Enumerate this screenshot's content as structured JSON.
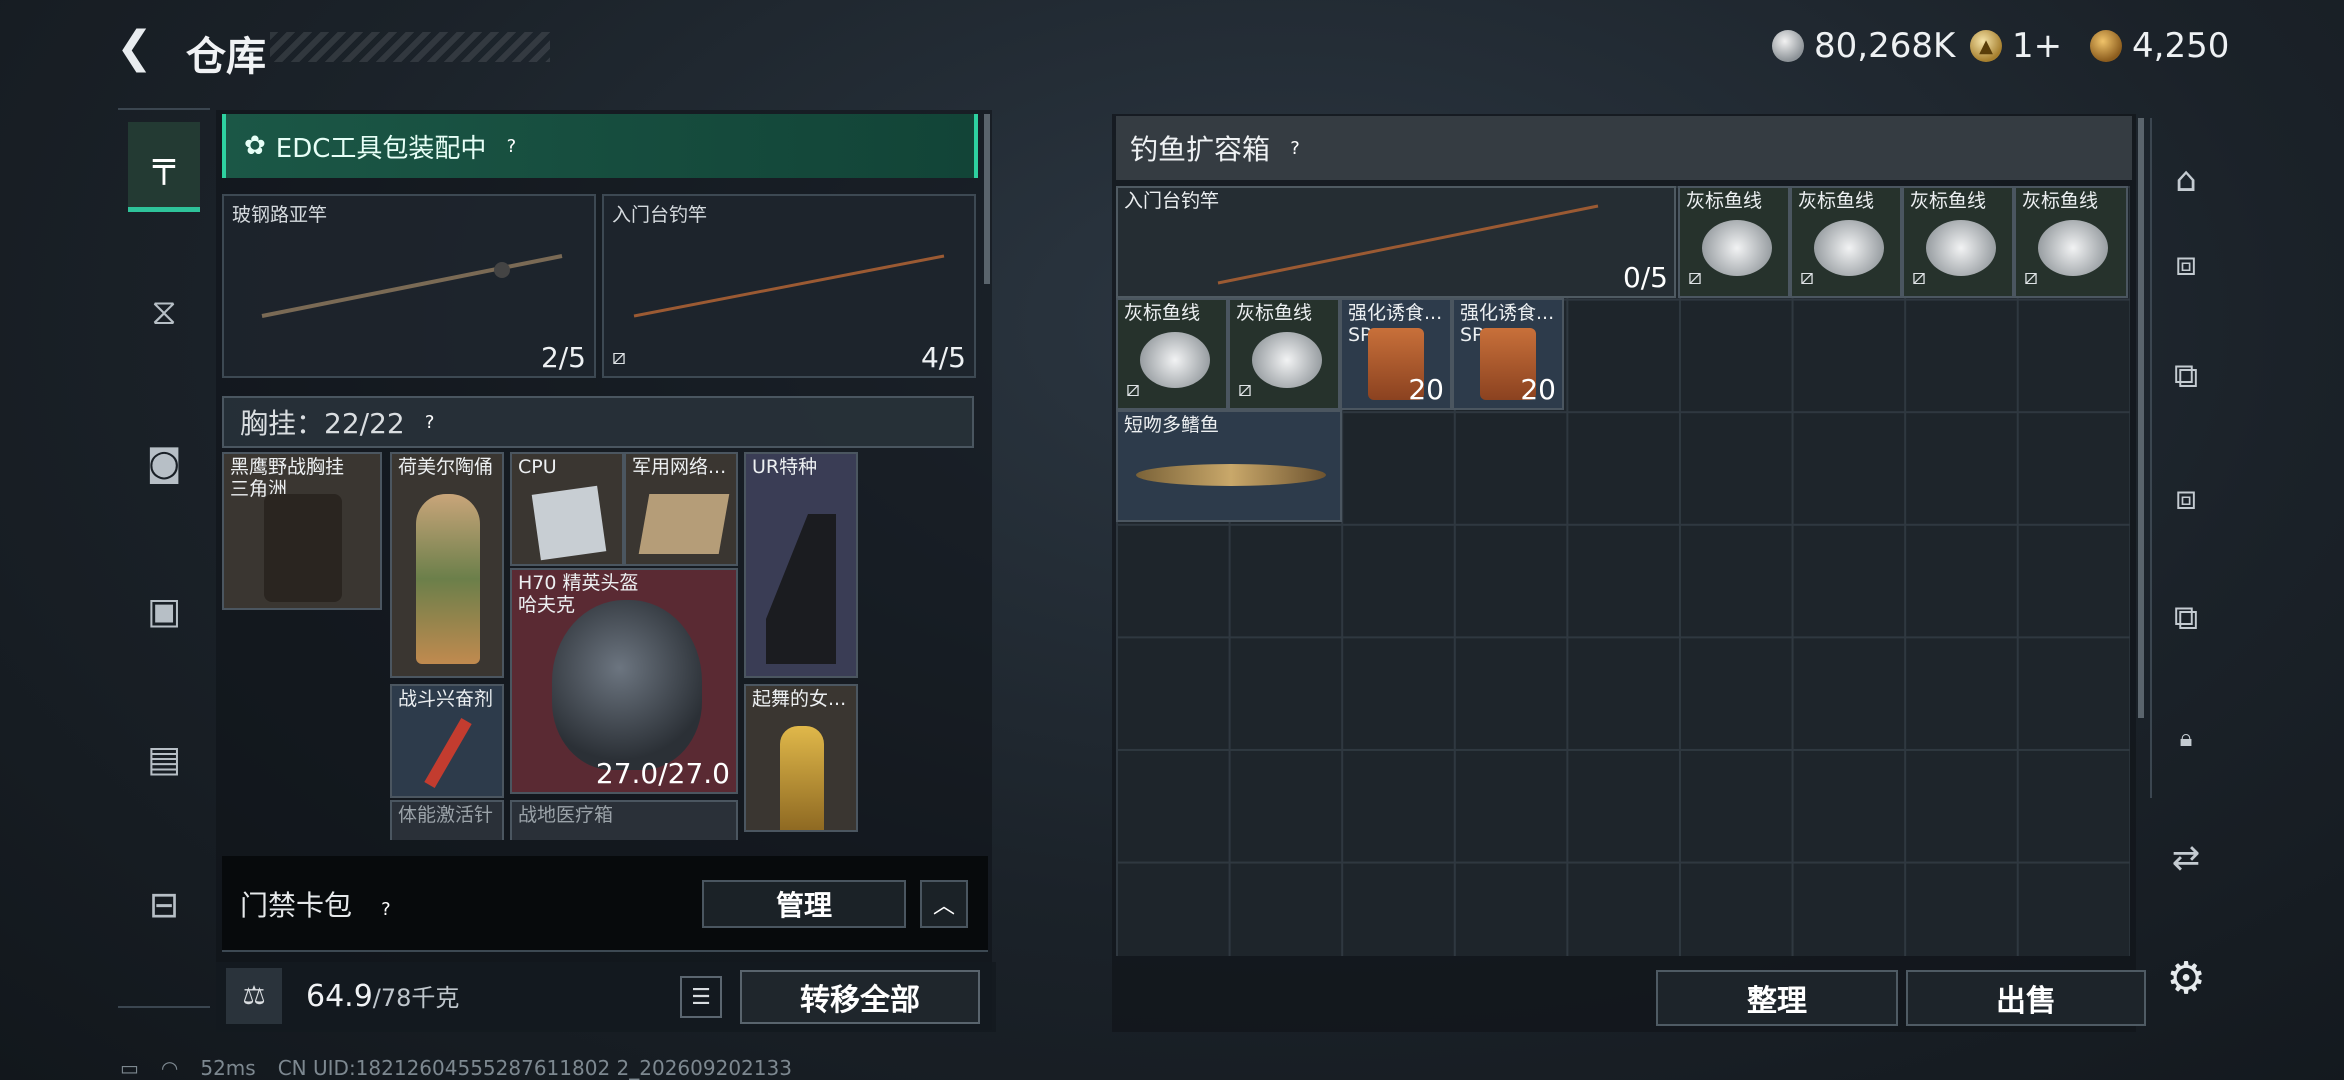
{
  "header": {
    "title": "仓库",
    "currencies": [
      {
        "icon": "silver-coin-icon",
        "value": "80,268K"
      },
      {
        "icon": "gold-ticket-icon",
        "value": "1+"
      },
      {
        "icon": "gold-coin-icon",
        "value": "4,250"
      }
    ]
  },
  "tabs": [
    {
      "name": "weapons",
      "icon": "pistol-icon",
      "active": true
    },
    {
      "name": "armor",
      "icon": "vest-icon",
      "active": false
    },
    {
      "name": "helmet",
      "icon": "helmet-icon",
      "active": false
    },
    {
      "name": "backpack",
      "icon": "backpack-icon",
      "active": false
    },
    {
      "name": "chest-rig",
      "icon": "rig-icon",
      "active": false
    },
    {
      "name": "case",
      "icon": "briefcase-icon",
      "active": false
    }
  ],
  "left": {
    "edc_label": "EDC工具包装配中",
    "rods": [
      {
        "label": "玻钢路亚竿",
        "count": "2/5"
      },
      {
        "label": "入门台钓竿",
        "count": "4/5"
      }
    ],
    "chest_label": "胸挂：22/22",
    "items": [
      {
        "label": "黑鹰野战胸挂\n三角洲"
      },
      {
        "label": "荷美尔陶俑"
      },
      {
        "label": "CPU"
      },
      {
        "label": "军用网络..."
      },
      {
        "label": "UR特种"
      },
      {
        "label": "H70 精英头盔\n哈夫克",
        "count": "27.0/27.0"
      },
      {
        "label": "战斗兴奋剂"
      },
      {
        "label": "起舞的女..."
      },
      {
        "label": "体能激活针"
      },
      {
        "label": "战地医疗箱"
      }
    ],
    "card_pack_label": "门禁卡包",
    "manage_label": "管理",
    "weight_value": "64.9",
    "weight_max": "/78千克",
    "transfer_label": "转移全部"
  },
  "right": {
    "title": "钓鱼扩容箱",
    "grid_items": [
      {
        "label": "入门台钓竿",
        "count": "0/5"
      },
      {
        "label": "灰标鱼线"
      },
      {
        "label": "灰标鱼线"
      },
      {
        "label": "灰标鱼线"
      },
      {
        "label": "灰标鱼线"
      },
      {
        "label": "灰标鱼线"
      },
      {
        "label": "灰标鱼线"
      },
      {
        "label": "强化诱食...",
        "sub": "SP",
        "count": "20"
      },
      {
        "label": "强化诱食...",
        "sub": "SP",
        "count": "20"
      },
      {
        "label": "短吻多鳍鱼"
      }
    ],
    "sort_label": "整理",
    "sell_label": "出售"
  },
  "status": {
    "ping": "52ms",
    "uid": "CN UID:18212604555287611802 2_202609202133"
  }
}
